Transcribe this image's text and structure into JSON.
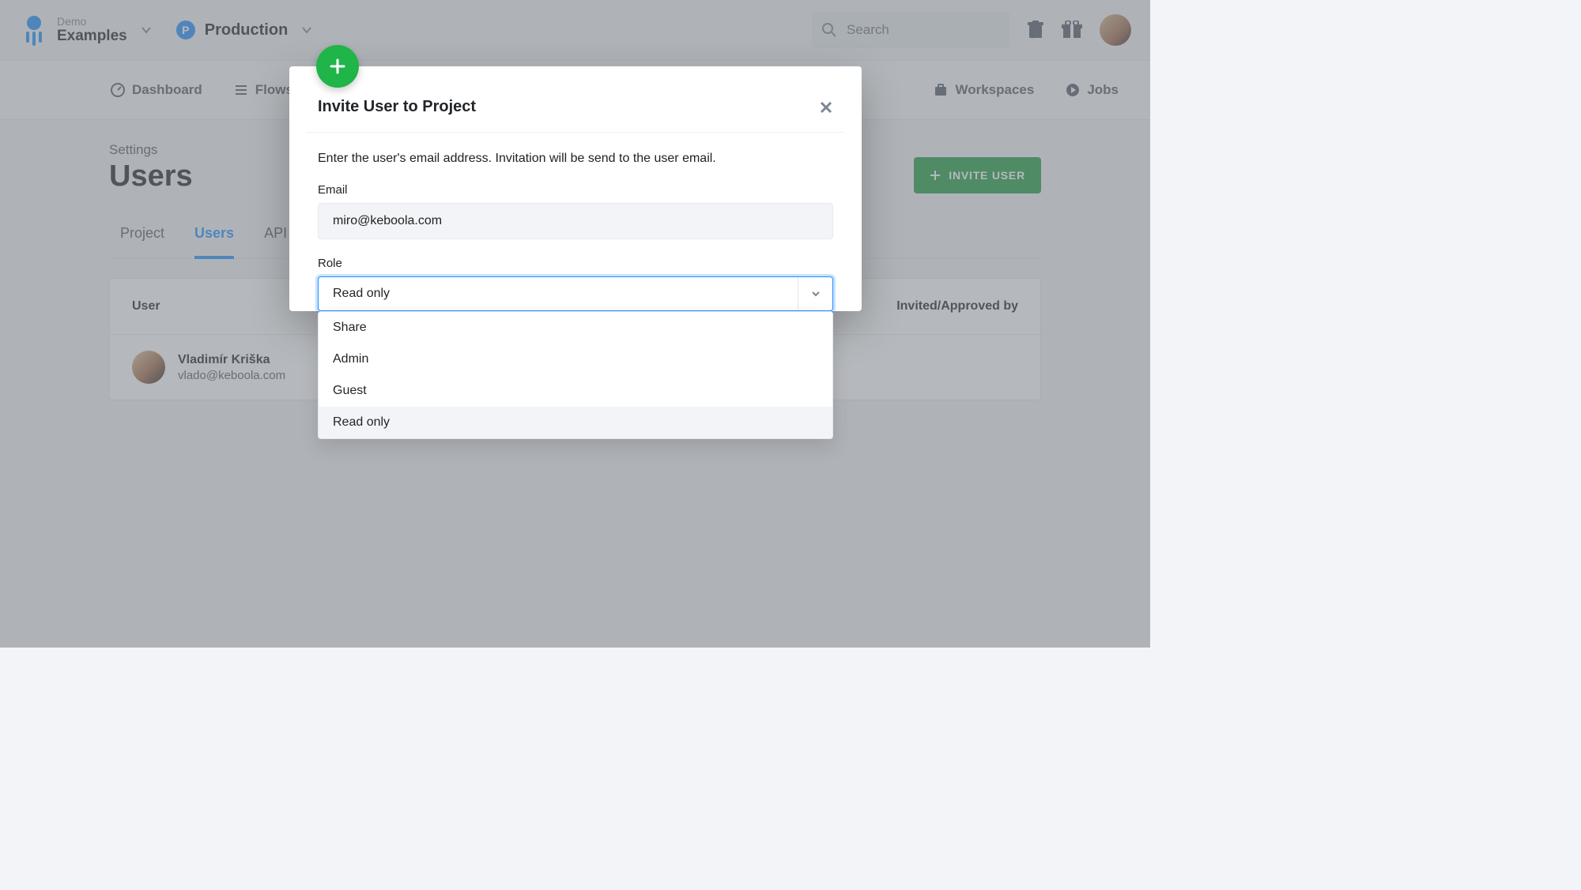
{
  "header": {
    "org_label": "Demo",
    "org_name": "Examples",
    "project_badge": "P",
    "project_name": "Production",
    "search_placeholder": "Search",
    "search_kbd": "/"
  },
  "nav": {
    "items": [
      {
        "label": "Dashboard"
      },
      {
        "label": "Flows"
      },
      {
        "label": "Workspaces"
      },
      {
        "label": "Jobs"
      }
    ]
  },
  "page": {
    "label": "Settings",
    "title": "Users",
    "invite_button": "INVITE USER"
  },
  "tabs": {
    "items": [
      {
        "label": "Project",
        "active": false
      },
      {
        "label": "Users",
        "active": true
      },
      {
        "label": "API",
        "active": false
      }
    ]
  },
  "table": {
    "col_user": "User",
    "col_invited": "Invited/Approved by",
    "rows": [
      {
        "name": "Vladimír Kriška",
        "email": "vlado@keboola.com"
      }
    ]
  },
  "modal": {
    "title": "Invite User to Project",
    "hint": "Enter the user's email address. Invitation will be send to the user email.",
    "email_label": "Email",
    "email_value": "miro@keboola.com",
    "role_label": "Role",
    "role_selected": "Read only",
    "role_options": [
      "Share",
      "Admin",
      "Guest",
      "Read only"
    ]
  }
}
